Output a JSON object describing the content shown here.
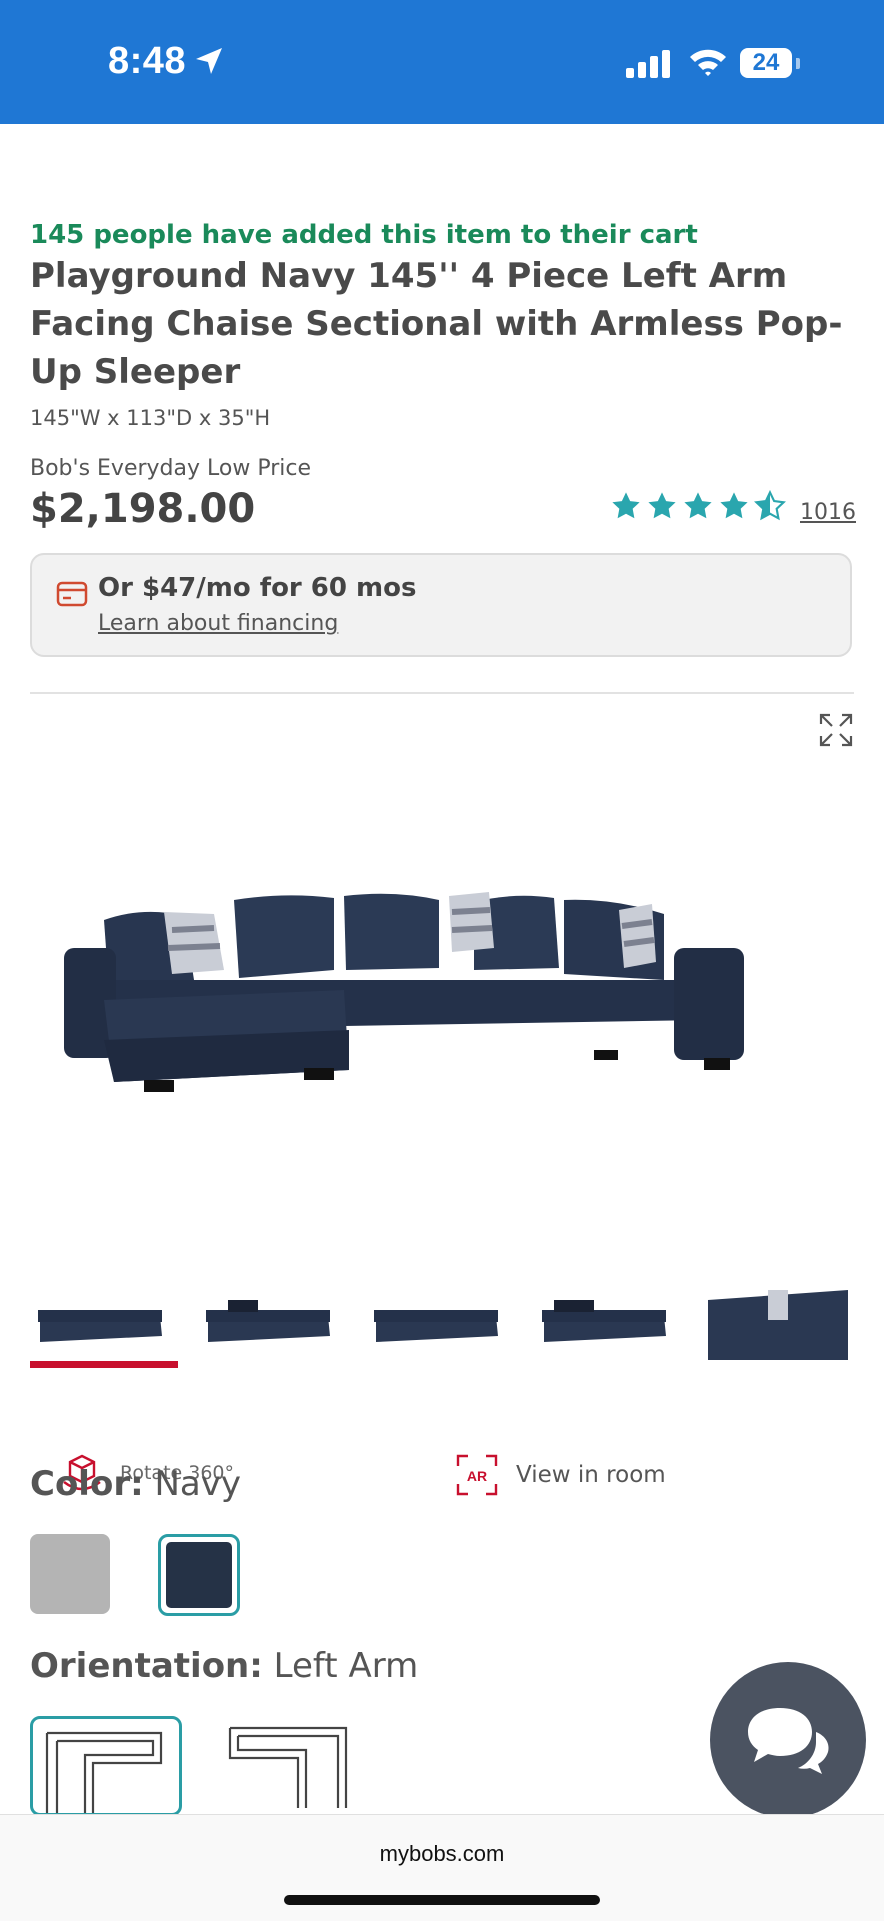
{
  "status_bar": {
    "time": "8:48",
    "battery": "24"
  },
  "product": {
    "cart_notice": "145 people have added this item to their cart",
    "title": "Playground Navy 145'' 4 Piece Left Arm Facing Chaise Sectional with Armless Pop-Up Sleeper",
    "dimensions": "145\"W x 113\"D x 35\"H",
    "price_label": "Bob's Everyday Low Price",
    "price": "$2,198.00",
    "rating": 4.5,
    "review_count": "1016"
  },
  "financing": {
    "text": "Or $47/mo for 60 mos",
    "link": "Learn about financing"
  },
  "gallery": {
    "thumbnail_count": 5,
    "selected_index": 0,
    "rotate_label": "Rotate 360°",
    "view_room_label": "View in room"
  },
  "options": {
    "color_label": "Color:",
    "color_value": "Navy",
    "colors": [
      "#b4b4b4",
      "#253246"
    ],
    "orientation_label": "Orientation:",
    "orientation_value": "Left Arm"
  },
  "browser": {
    "domain": "mybobs.com"
  },
  "colors": {
    "status_bar": "#1f77d4",
    "accent_teal": "#2a9da5",
    "accent_red": "#c8102e",
    "notice_green": "#1a8a5a"
  }
}
